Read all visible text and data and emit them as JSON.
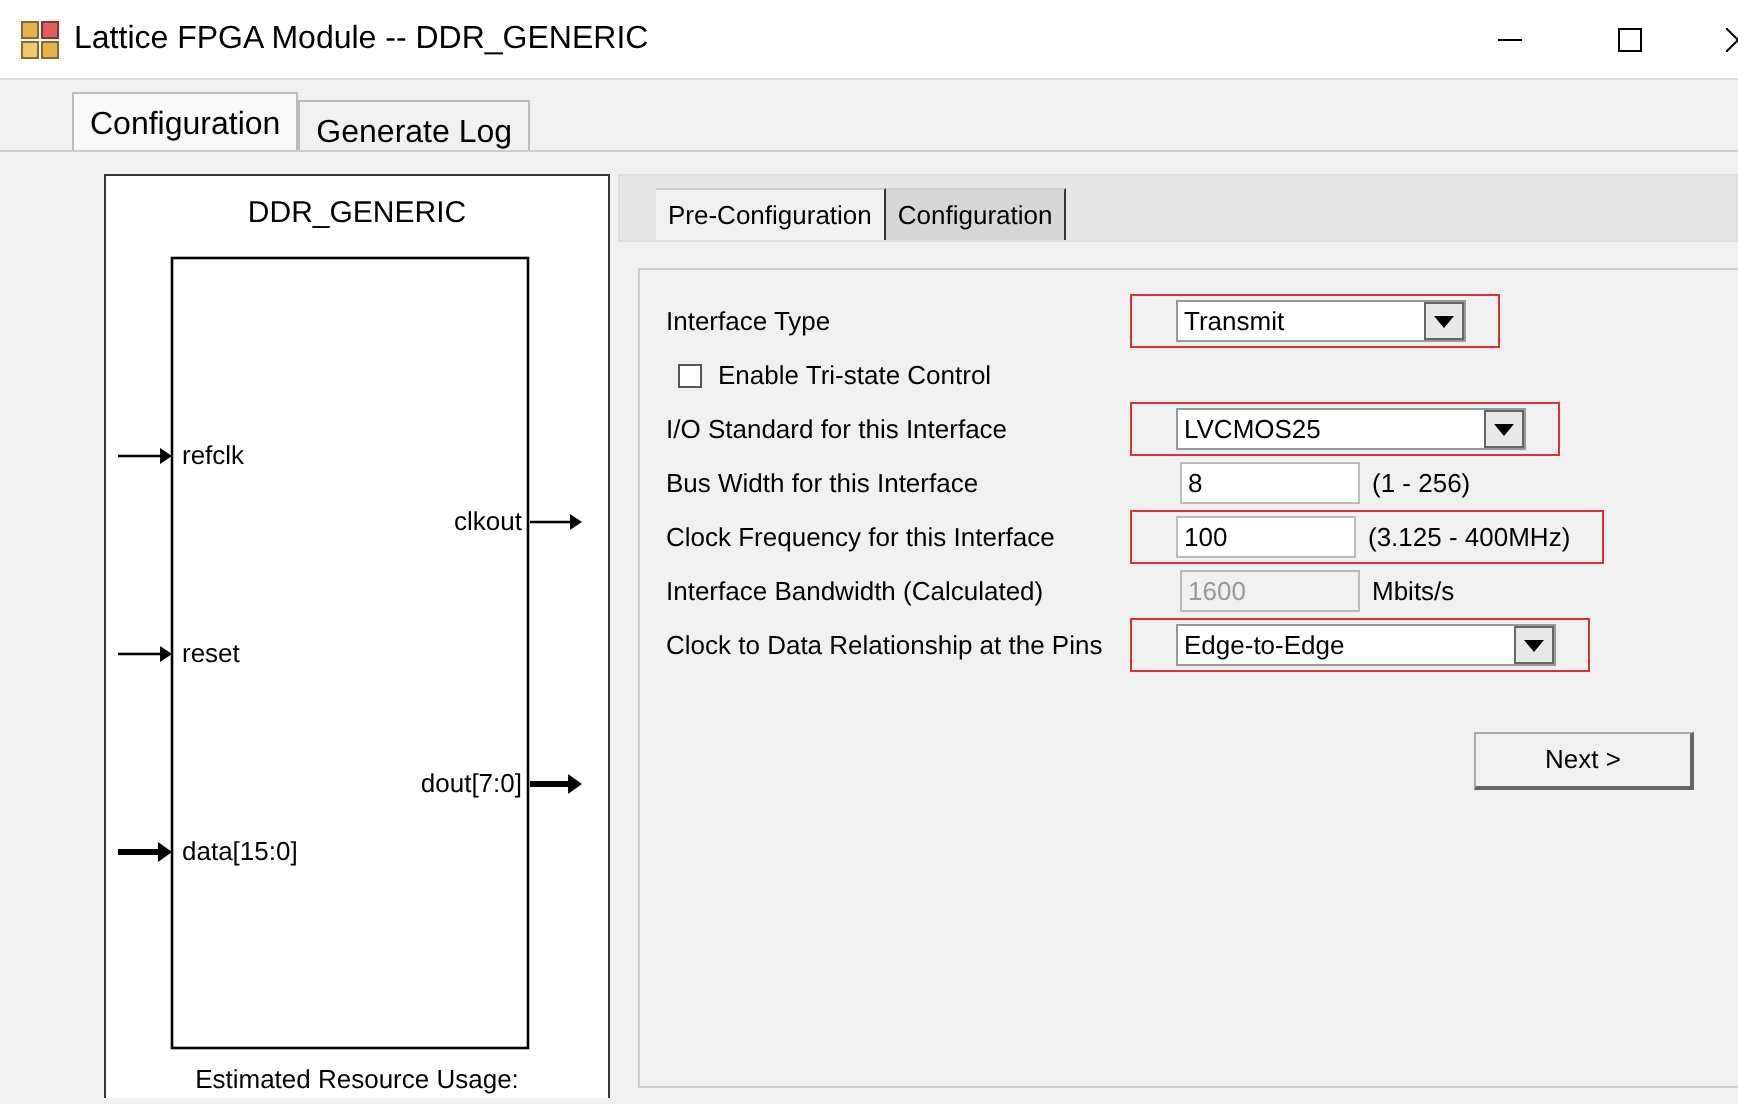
{
  "window": {
    "title": "Lattice FPGA Module -- DDR_GENERIC"
  },
  "tabs": [
    {
      "label": "Configuration",
      "selected": true
    },
    {
      "label": "Generate Log",
      "selected": false
    }
  ],
  "diagram": {
    "title": "DDR_GENERIC",
    "footer": "Estimated Resource Usage:",
    "left_pins": [
      {
        "label": "refclk",
        "bus": false
      },
      {
        "label": "reset",
        "bus": false
      },
      {
        "label": "data[15:0]",
        "bus": true
      }
    ],
    "right_pins": [
      {
        "label": "clkout",
        "bus": false
      },
      {
        "label": "dout[7:0]",
        "bus": true
      }
    ]
  },
  "sub_tabs": [
    {
      "label": "Pre-Configuration",
      "selected": true
    },
    {
      "label": "Configuration",
      "selected": false
    }
  ],
  "fields": [
    {
      "kind": "select",
      "label": "Interface Type",
      "value": "Transmit",
      "highlighted": true
    },
    {
      "kind": "checkbox",
      "label": "Enable Tri-state Control",
      "checked": false
    },
    {
      "kind": "select",
      "label": "I/O Standard for this Interface",
      "value": "LVCMOS25",
      "highlighted": true
    },
    {
      "kind": "input",
      "label": "Bus Width for this Interface",
      "value": "8",
      "unit": "(1 - 256)"
    },
    {
      "kind": "input",
      "label": "Clock Frequency for this Interface",
      "value": "100",
      "unit": "(3.125 - 400MHz)",
      "highlighted": true
    },
    {
      "kind": "readonly",
      "label": "Interface Bandwidth (Calculated)",
      "value": "1600",
      "unit": "Mbits/s"
    },
    {
      "kind": "select",
      "label": "Clock to Data Relationship at the Pins",
      "value": "Edge-to-Edge",
      "highlighted": true
    }
  ],
  "next_button": "Next >"
}
